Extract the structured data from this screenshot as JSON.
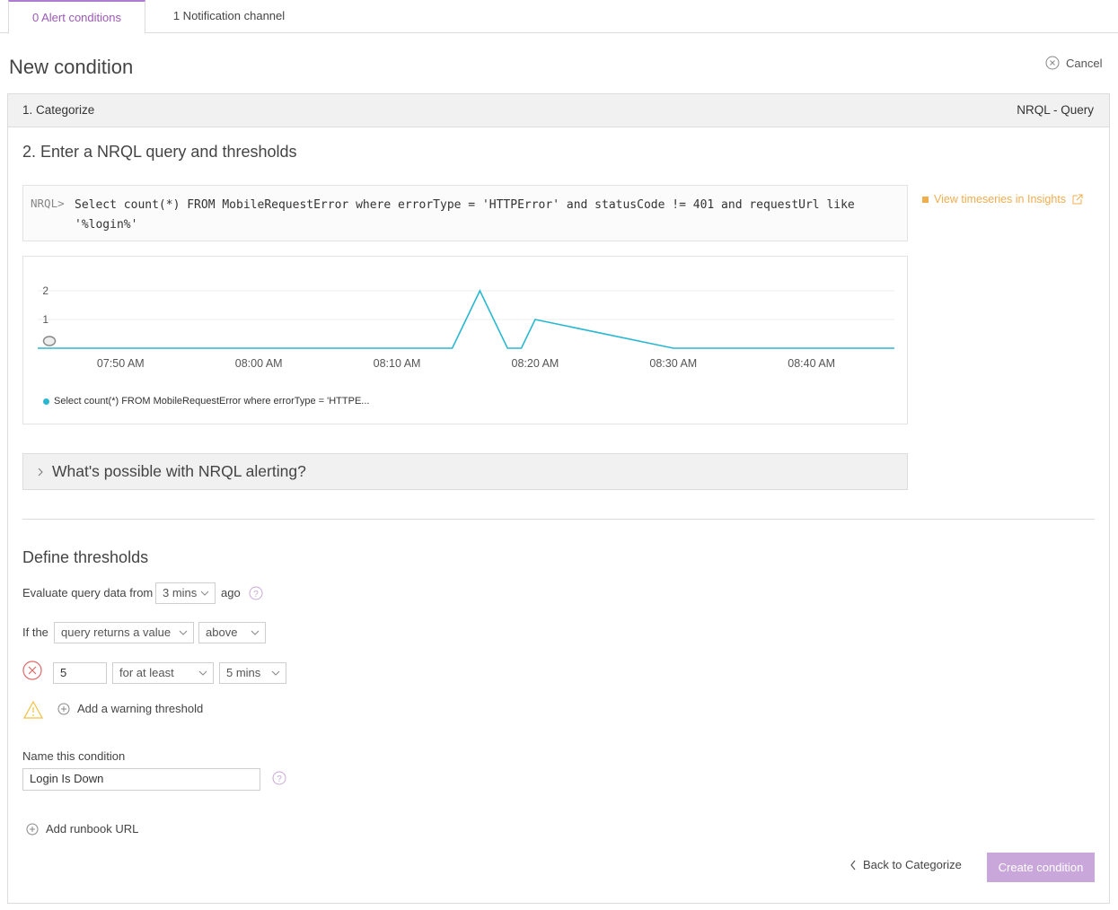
{
  "tabs": [
    {
      "label": "0 Alert conditions"
    },
    {
      "label": "1 Notification channel"
    }
  ],
  "page": {
    "title": "New condition",
    "cancel_label": "Cancel"
  },
  "step1": {
    "title": "1. Categorize",
    "type": "NRQL - Query"
  },
  "step2": {
    "title": "2. Enter a NRQL query and thresholds",
    "prompt": "NRQL>",
    "query": "Select count(*) FROM MobileRequestError where errorType = 'HTTPError' and statusCode != 401 and requestUrl like '%login%'",
    "insights_link": "View timeseries in Insights"
  },
  "chart_data": {
    "type": "line",
    "x": [
      "07:44 AM",
      "07:50 AM",
      "08:00 AM",
      "08:10 AM",
      "08:14 AM",
      "08:16 AM",
      "08:18 AM",
      "08:19 AM",
      "08:20 AM",
      "08:30 AM",
      "08:40 AM",
      "08:46 AM"
    ],
    "series": [
      {
        "name": "Select count(*) FROM MobileRequestError where errorType = 'HTTPE...",
        "values": [
          0,
          0,
          0,
          0,
          0,
          2,
          0,
          0,
          1,
          0,
          0,
          0
        ],
        "color": "#2ab8d0"
      }
    ],
    "yticks": [
      "1",
      "2"
    ],
    "xticks": [
      "07:50 AM",
      "08:00 AM",
      "08:10 AM",
      "08:20 AM",
      "08:30 AM",
      "08:40 AM"
    ],
    "ylim": [
      0,
      2
    ],
    "grid": true,
    "legend": "bottom-left"
  },
  "accordion": {
    "title": "What's possible with NRQL alerting?"
  },
  "thresholds": {
    "title": "Define thresholds",
    "evaluate_label": "Evaluate query data from",
    "evaluate_value": "3 mins",
    "ago_label": "ago",
    "if_label": "If the",
    "query_returns": "query returns a value",
    "comparison": "above",
    "critical_value": "5",
    "for_at_least": "for at least",
    "duration": "5 mins",
    "add_warning": "Add a warning threshold"
  },
  "name_section": {
    "label": "Name this condition",
    "value": "Login Is Down"
  },
  "runbook": {
    "label": "Add runbook URL"
  },
  "footer": {
    "back_label": "Back to Categorize",
    "create_label": "Create condition"
  },
  "colors": {
    "accent": "#9b59b6",
    "series": "#2ab8d0",
    "critical": "#e06666",
    "warning": "#f0c040",
    "insights": "#f0ad4e"
  }
}
